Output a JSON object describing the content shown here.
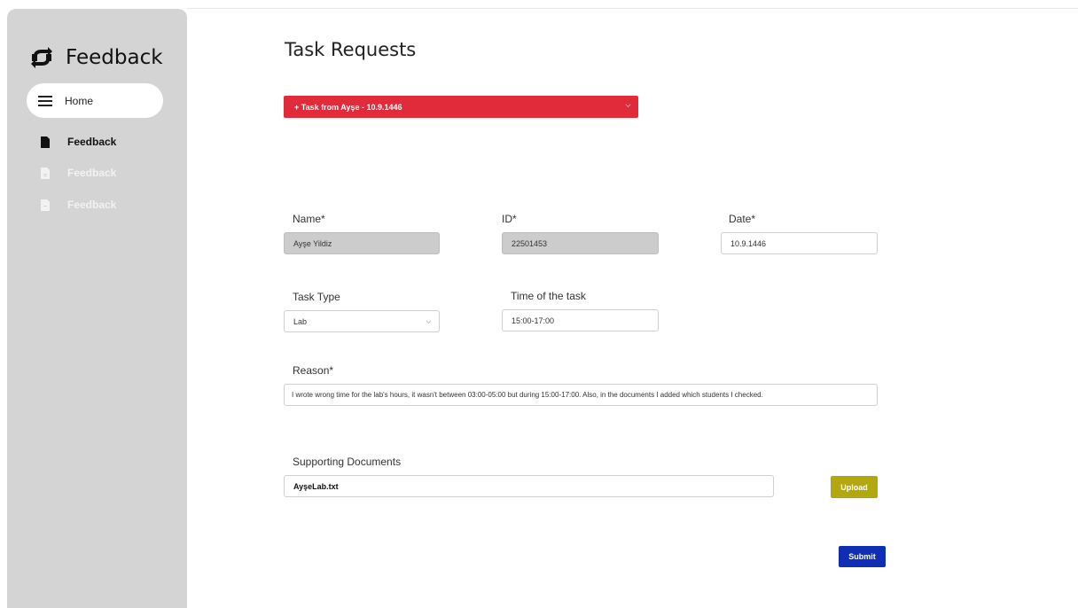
{
  "sidebar": {
    "brand_title": "Feedback",
    "brand_icon": "sync-icon",
    "home_label": "Home",
    "items": [
      {
        "label": "Feedback",
        "icon": "document-icon",
        "state": "active"
      },
      {
        "label": "Feedback",
        "icon": "document-icon",
        "state": "muted"
      },
      {
        "label": "Feedback",
        "icon": "document-icon",
        "state": "muted"
      }
    ]
  },
  "main": {
    "title": "Task Requests",
    "request_bar": {
      "label": "+ Task from Ayşe - 10.9.1446",
      "color": "#e12a3a"
    },
    "form": {
      "name_label": "Name*",
      "name_value": "Ayşe Yildiz",
      "id_label": "ID*",
      "id_value": "22501453",
      "date_label": "Date*",
      "date_value": "10.9.1446",
      "task_type_label": "Task Type",
      "task_type_value": "Lab",
      "time_label": "Time of the task",
      "time_value": "15:00-17:00",
      "reason_label": "Reason*",
      "reason_value": "I wrote wrong time for the lab's hours, it wasn't between 03:00-05:00 but during 15:00-17:00. Also, in the documents I added which students I checked.",
      "docs_label": "Supporting Documents",
      "docs_value": "AyşeLab.txt",
      "upload_label": "Upload",
      "submit_label": "Submit"
    }
  },
  "colors": {
    "sidebar_bg": "#d4d4d4",
    "request_bar": "#e12a3a",
    "upload_button": "#b3a70e",
    "submit_button": "#0f2eb4"
  }
}
